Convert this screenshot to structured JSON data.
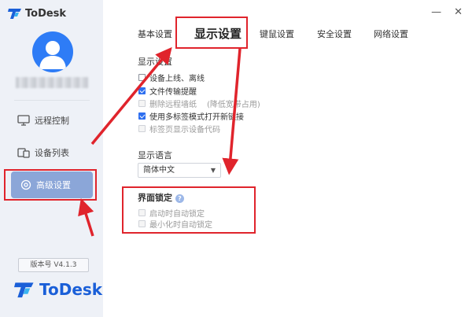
{
  "app": {
    "name": "ToDesk",
    "version": "版本号 V4.1.3"
  },
  "window": {
    "minimize_glyph": "—",
    "close_glyph": "✕"
  },
  "sidebar": {
    "items": [
      {
        "label": "远程控制",
        "icon": "monitor-icon"
      },
      {
        "label": "设备列表",
        "icon": "devices-icon"
      },
      {
        "label": "高级设置",
        "icon": "settings-gear-icon",
        "active": true
      }
    ]
  },
  "tabs": [
    {
      "label": "基本设置"
    },
    {
      "label": "显示设置",
      "active": true
    },
    {
      "label": "键鼠设置"
    },
    {
      "label": "安全设置"
    },
    {
      "label": "网络设置"
    }
  ],
  "display_section": {
    "title": "显示设置",
    "options": [
      {
        "label": "设备上线、离线",
        "checked": false,
        "disabled": false
      },
      {
        "label": "文件传输提醒",
        "checked": true,
        "disabled": false
      },
      {
        "label": "删除远程墙纸",
        "checked": false,
        "disabled": true,
        "hint": "(降低宽带占用)"
      },
      {
        "label": "使用多标签模式打开新链接",
        "checked": true,
        "disabled": false
      },
      {
        "label": "标签页显示设备代码",
        "checked": false,
        "disabled": true
      }
    ]
  },
  "language_section": {
    "title": "显示语言",
    "selected": "简体中文",
    "caret": "▼"
  },
  "lock_section": {
    "title": "界面锁定",
    "help_glyph": "?",
    "options": [
      {
        "label": "启动时自动锁定",
        "checked": false,
        "disabled": true
      },
      {
        "label": "最小化时自动锁定",
        "checked": false,
        "disabled": true
      }
    ]
  },
  "colors": {
    "accent": "#2e6ff0",
    "brand": "#1a5fd8",
    "annotation": "#e0242c",
    "sidebar_active": "#8ba6d8"
  }
}
